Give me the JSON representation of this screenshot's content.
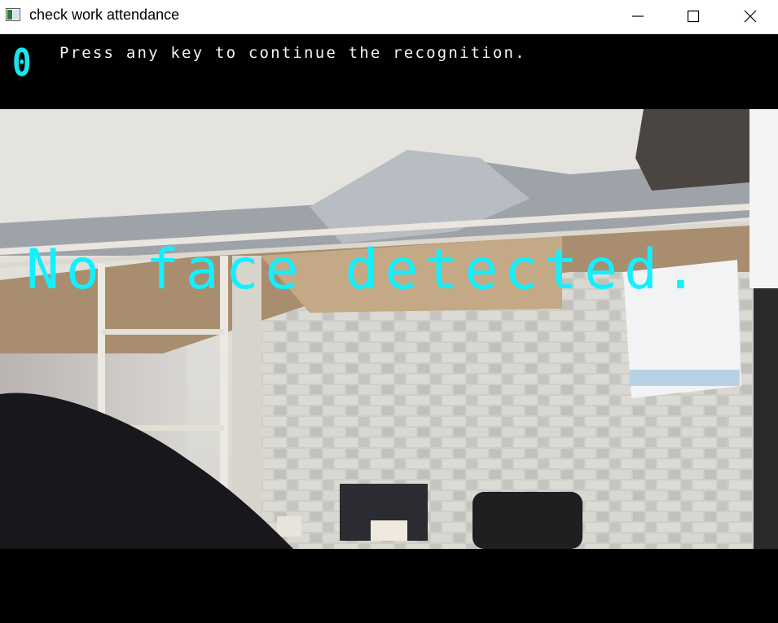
{
  "window": {
    "title": "check work attendance",
    "controls": [
      "minimize-icon",
      "maximize-icon",
      "close-icon"
    ]
  },
  "overlay": {
    "counter": "0",
    "prompt": "Press any key to continue the recognition.",
    "status": "No face detected."
  },
  "colors": {
    "overlay_cyan": "#17e6f0",
    "prompt_white": "#f4f4f4",
    "letterbox_black": "#000000"
  }
}
